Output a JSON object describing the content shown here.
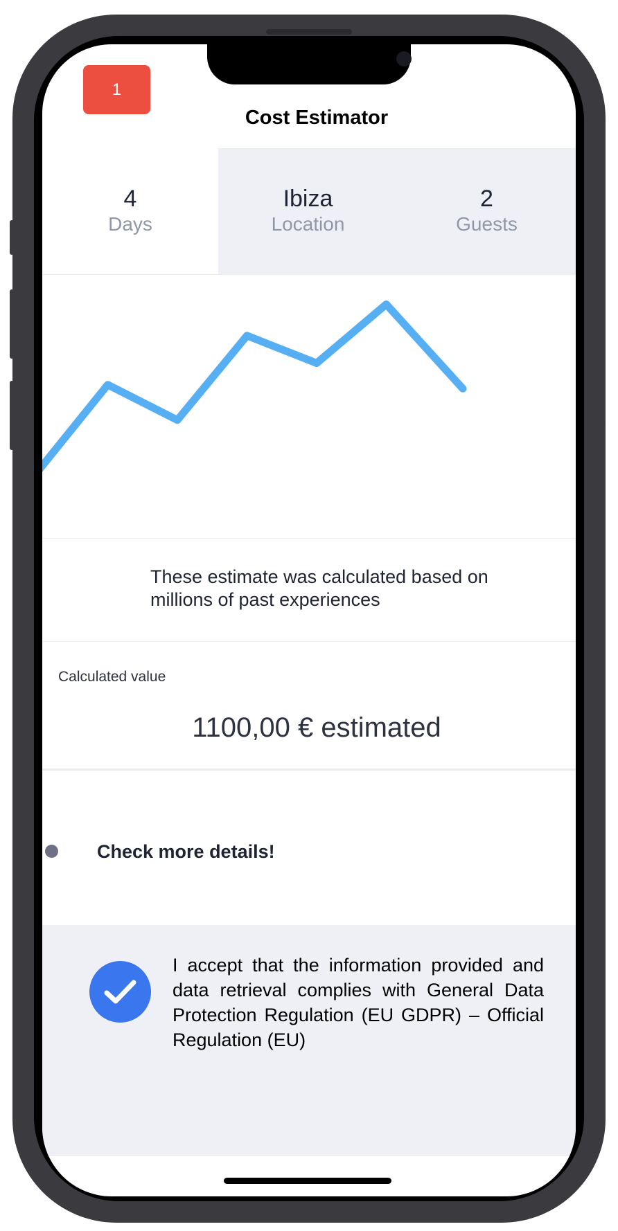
{
  "app": {
    "badge_count": "1",
    "title": "Cost Estimator"
  },
  "stats": [
    {
      "value": "4",
      "label": "Days"
    },
    {
      "value": "Ibiza",
      "label": "Location"
    },
    {
      "value": "2",
      "label": "Guests"
    }
  ],
  "chart_data": {
    "type": "line",
    "x": [
      0,
      1,
      2,
      3,
      4,
      5,
      6,
      7
    ],
    "values": [
      2,
      6.4,
      4.6,
      8.9,
      7.5,
      10.5,
      6.2,
      6.2
    ],
    "color": "#56aef3",
    "grid": false,
    "legend": false
  },
  "info_text": "These estimate was calculated based on millions of past experiences",
  "calculated": {
    "label": "Calculated value",
    "value": "1100,00 € estimated"
  },
  "details": {
    "label": "Check more details!"
  },
  "consent": {
    "checked": true,
    "text": "I accept that the information provided and data retrieval complies with General Data Protection Regulation (EU GDPR) – Official Regulation (EU)"
  },
  "colors": {
    "accent": "#3a77ee",
    "badge": "#ec4e40",
    "line": "#56aef3",
    "panel": "#eff0f5"
  }
}
